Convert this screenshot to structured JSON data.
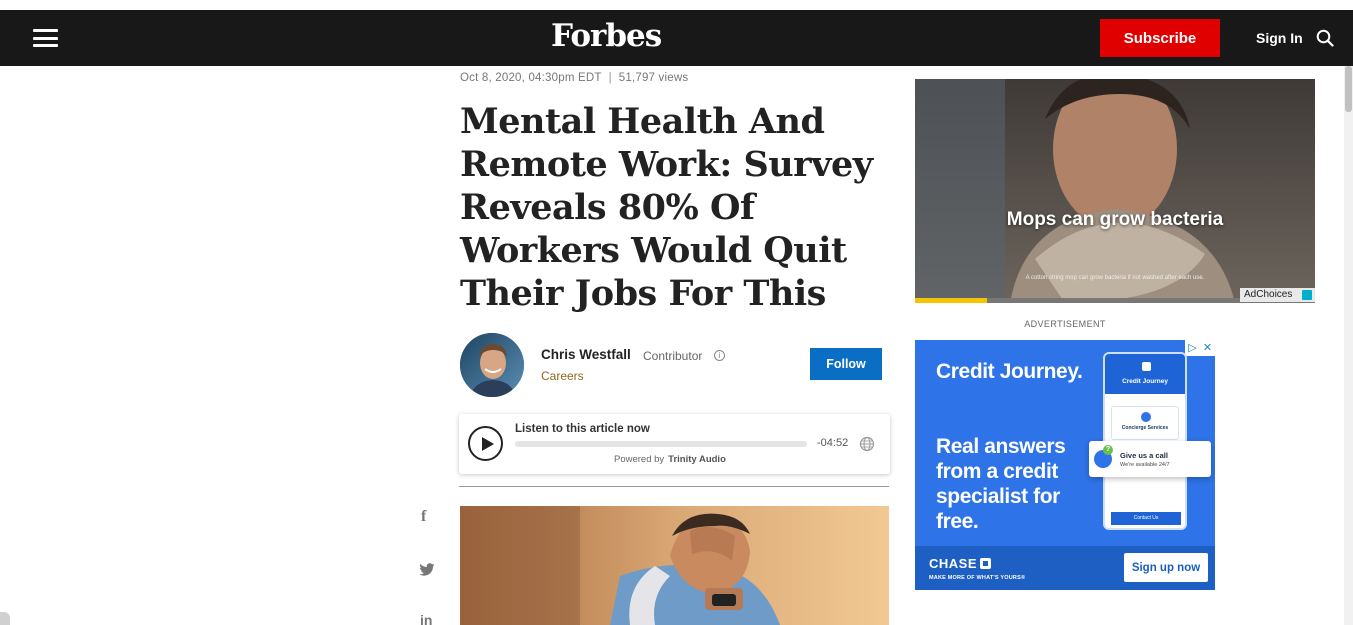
{
  "header": {
    "logo": "Forbes",
    "subscribe_label": "Subscribe",
    "signin_label": "Sign In"
  },
  "article": {
    "date": "Oct 8, 2020, 04:30pm EDT",
    "separator": "|",
    "views": "51,797 views",
    "headline": "Mental Health And Remote Work: Survey Reveals 80% Of Workers Would Quit Their Jobs For This",
    "author": {
      "name": "Chris Westfall",
      "role": "Contributor",
      "info_glyph": "i",
      "channel": "Careers",
      "follow_label": "Follow"
    }
  },
  "audio_player": {
    "label": "Listen to this article now",
    "duration": "-04:52",
    "powered_by": "Powered by",
    "provider": "Trinity Audio",
    "progress": 0
  },
  "share": {
    "facebook_glyph": "f",
    "linkedin_glyph": "in"
  },
  "ads": {
    "video_ad": {
      "caption": "Mops can grow bacteria",
      "fine_print": "A cotton string mop can grow bacteria if not washed after each use.",
      "progress": 0.18,
      "adchoices_label": "AdChoices"
    },
    "advertisement_label": "ADVERTISEMENT",
    "chase_ad": {
      "title": "Credit Journey.",
      "body": "Real answers from a credit specialist for free.",
      "phone_header": "Credit Journey",
      "phone_card": "Concierge Services",
      "phone_button": "Contact Us",
      "callout_q": "?",
      "callout_title": "Give us a call",
      "callout_sub": "We're available 24/7",
      "brand": "CHASE",
      "tagline": "MAKE MORE OF WHAT'S YOURS®",
      "cta": "Sign up now",
      "adchoice_glyph": "▷",
      "close_glyph": "✕"
    }
  },
  "colors": {
    "nav_bg": "#181818",
    "subscribe": "#e00000",
    "follow": "#0a6ec4",
    "chase_blue": "#2e73e7"
  }
}
